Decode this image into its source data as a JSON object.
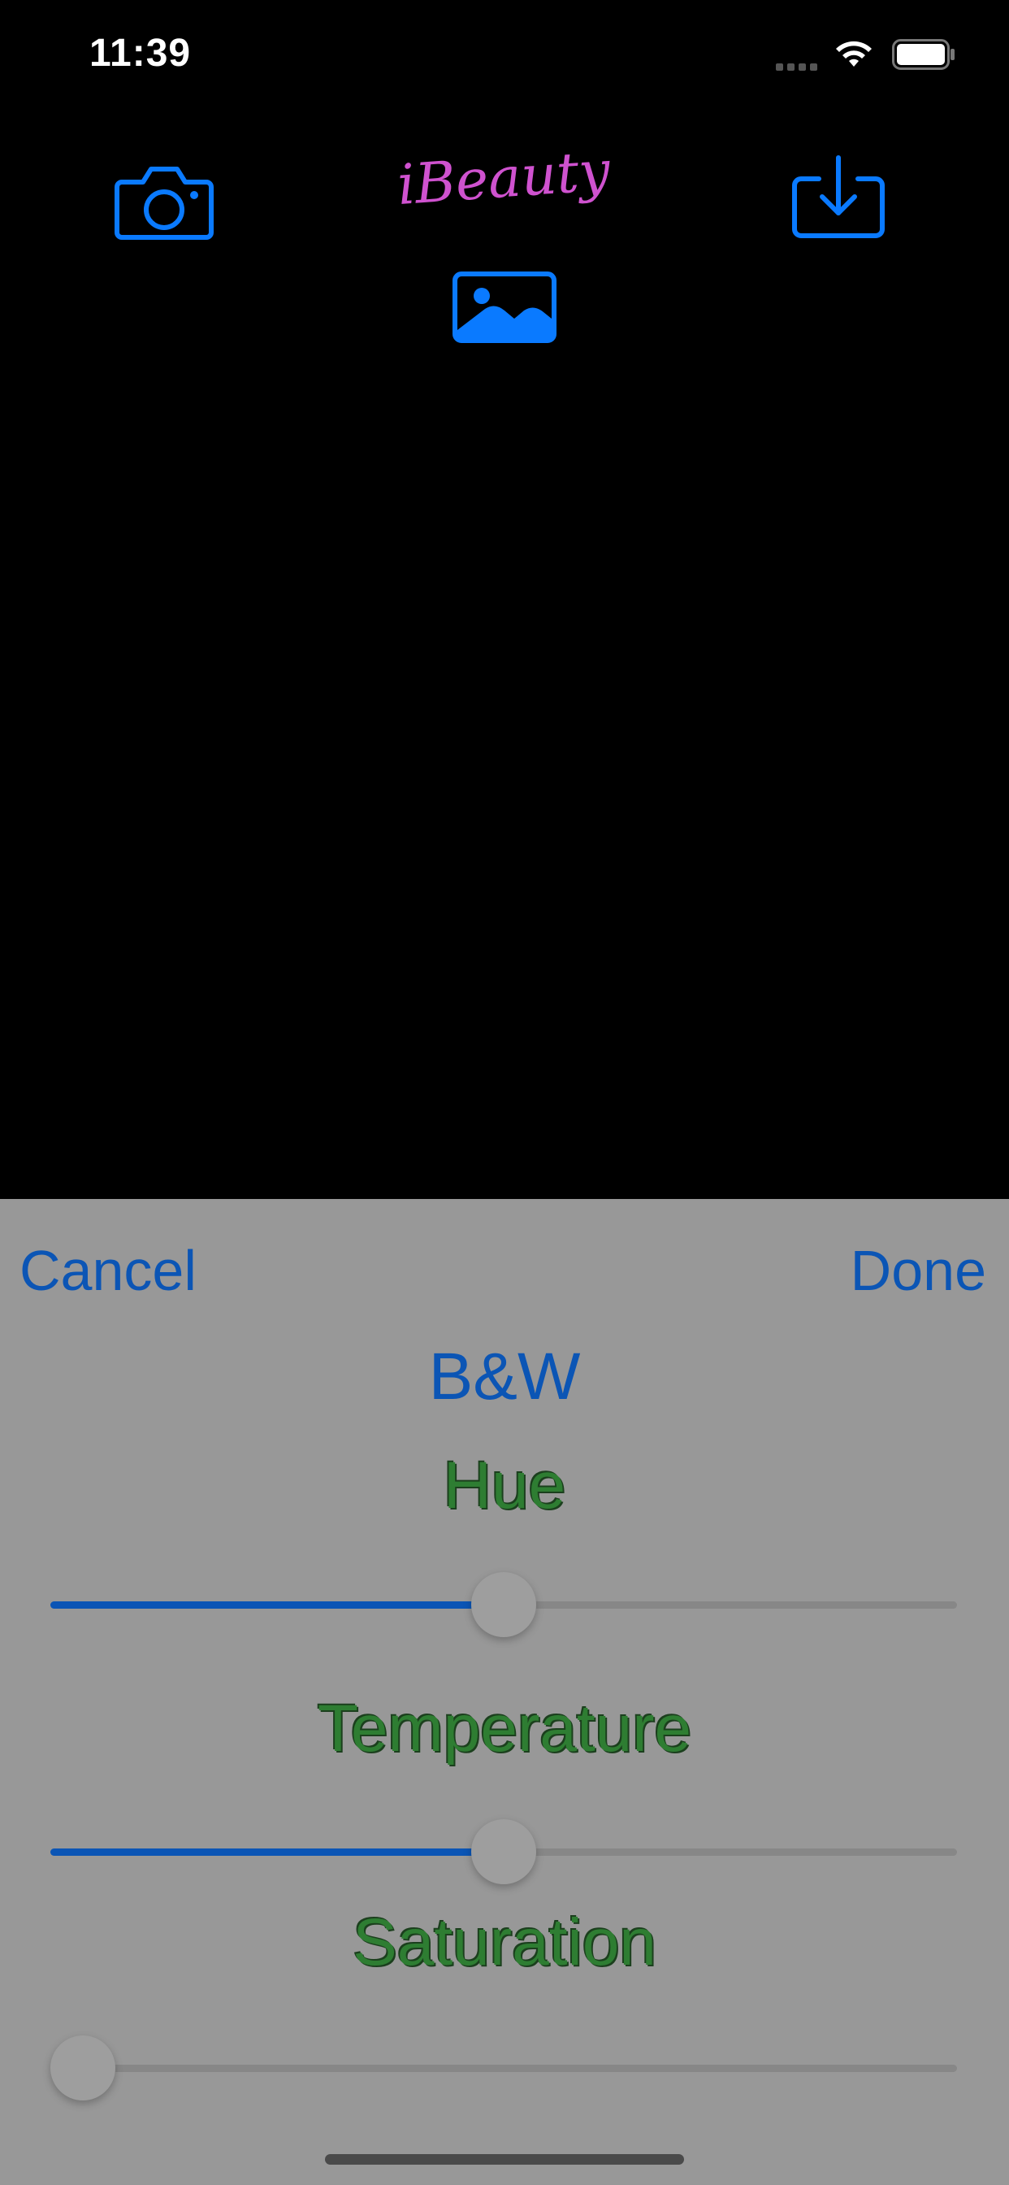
{
  "status_bar": {
    "time": "11:39"
  },
  "header": {
    "app_title": "iBeauty",
    "camera_icon": "camera-icon",
    "share_icon": "download-tray-icon",
    "photo_icon": "photo-library-icon",
    "accent_color": "#0a7aff",
    "title_color": "#cf52cf"
  },
  "panel": {
    "cancel_label": "Cancel",
    "done_label": "Done",
    "filter_name": "B&W",
    "sliders": [
      {
        "label": "Hue",
        "value": 0.5
      },
      {
        "label": "Temperature",
        "value": 0.5
      },
      {
        "label": "Saturation",
        "value": 0.0
      }
    ],
    "button_color": "#0b55b5",
    "label_color": "#2e7d32"
  }
}
